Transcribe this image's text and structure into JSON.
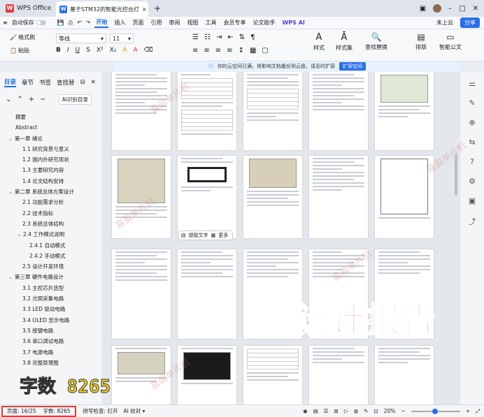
{
  "titlebar": {
    "home_tab": "WPS Office",
    "doc_tab": "基于STM32的智能光控台灯",
    "new_tab_icon": "plus-icon",
    "window_controls": [
      "minimize-icon",
      "maximize-icon",
      "close-icon"
    ]
  },
  "menubar": {
    "autosave": "自动保存",
    "items": [
      "开始",
      "插入",
      "页面",
      "引用",
      "审阅",
      "视图",
      "工具",
      "会员专享",
      "论文助手"
    ],
    "active": "开始",
    "wps_ai": "WPS AI",
    "cloud": "未上云",
    "share": "分享"
  },
  "ribbon": {
    "format_painter": "格式刷",
    "paste": "粘贴",
    "font_name": "等线",
    "font_size": "11",
    "style": "样式",
    "style_set": "样式集",
    "find_replace": "查找替换",
    "layout": "排版",
    "smart_doc": "智能公文"
  },
  "notice": {
    "text": "你的云空间已满，将影响文档备份到云盘，请及时扩容",
    "button": "扩容空间"
  },
  "sidebar": {
    "tabs": [
      "目录",
      "章节",
      "书签",
      "查找替"
    ],
    "active_tab": "目录",
    "ai_toc": "AI识别目录",
    "toc": [
      {
        "label": "摘要",
        "level": 0
      },
      {
        "label": "Abstract",
        "level": 0
      },
      {
        "label": "第一章 绪论",
        "level": 1
      },
      {
        "label": "1.1 研究背景与意义",
        "level": 2
      },
      {
        "label": "1.2 国内外研究现状",
        "level": 2
      },
      {
        "label": "1.3 主要研究内容",
        "level": 2
      },
      {
        "label": "1.4 论文结构安排",
        "level": 2
      },
      {
        "label": "第二章 系统总体方案设计",
        "level": 1
      },
      {
        "label": "2.1 功能需求分析",
        "level": 2
      },
      {
        "label": "2.2 技术指标",
        "level": 2
      },
      {
        "label": "2.3 系统总体结构",
        "level": 2
      },
      {
        "label": "2.4 工作模式说明",
        "level": 2
      },
      {
        "label": "2.4.1 自动模式",
        "level": 3
      },
      {
        "label": "2.4.2 手动模式",
        "level": 3
      },
      {
        "label": "2.5 设计开发环境",
        "level": 2
      },
      {
        "label": "第三章 硬件电路设计",
        "level": 1
      },
      {
        "label": "3.1 主控芯片选型",
        "level": 2
      },
      {
        "label": "3.2 光照采集电路",
        "level": 2
      },
      {
        "label": "3.3 LED 驱动电路",
        "level": 2
      },
      {
        "label": "3.4 OLED 显示电路",
        "level": 2
      },
      {
        "label": "3.5 按键电路",
        "level": 2
      },
      {
        "label": "3.6 串口调试电路",
        "level": 2
      },
      {
        "label": "3.7 电源电路",
        "level": 2
      },
      {
        "label": "3.8 完整原理图",
        "level": 2
      }
    ]
  },
  "popup": {
    "extract": "提取文字",
    "more": "更多"
  },
  "statusbar": {
    "page": "页面: 16/25",
    "words": "字数: 8265",
    "spellcheck": "拼写检查: 打开",
    "ai_check": "AI 校对",
    "zoom": "20%"
  },
  "overlays": {
    "big_title": "设计报告",
    "word_count": "字数 8265",
    "watermark": "嘉盈单片机"
  },
  "colors": {
    "accent": "#1f6fe5",
    "overlay_red": "#e53935",
    "overlay_yellow": "#f2d21f"
  }
}
